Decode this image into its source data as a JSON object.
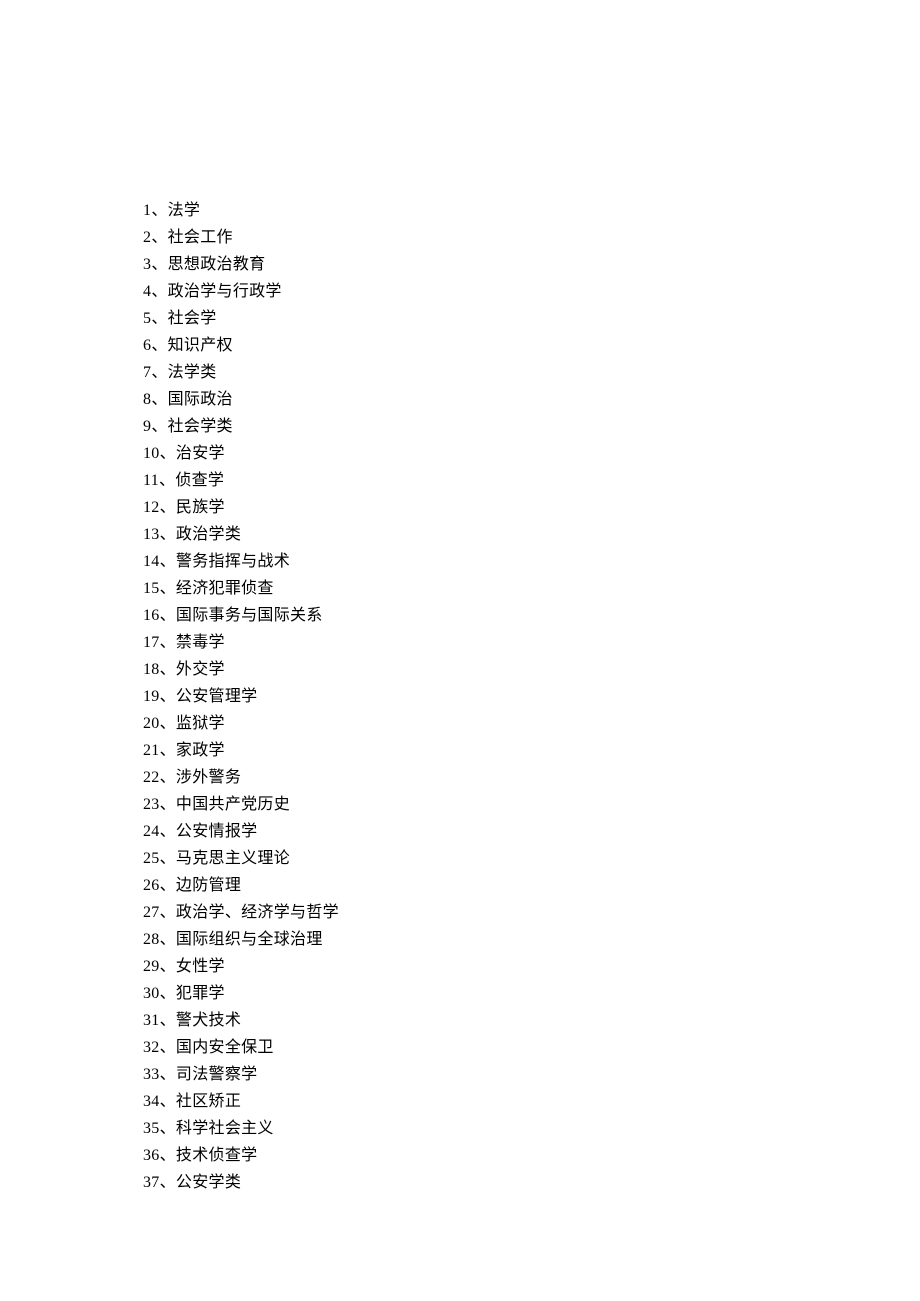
{
  "items": [
    {
      "num": "1",
      "label": "法学"
    },
    {
      "num": "2",
      "label": "社会工作"
    },
    {
      "num": "3",
      "label": "思想政治教育"
    },
    {
      "num": "4",
      "label": "政治学与行政学"
    },
    {
      "num": "5",
      "label": "社会学"
    },
    {
      "num": "6",
      "label": "知识产权"
    },
    {
      "num": "7",
      "label": "法学类"
    },
    {
      "num": "8",
      "label": "国际政治"
    },
    {
      "num": "9",
      "label": "社会学类"
    },
    {
      "num": "10",
      "label": "治安学"
    },
    {
      "num": "11",
      "label": "侦查学"
    },
    {
      "num": "12",
      "label": "民族学"
    },
    {
      "num": "13",
      "label": "政治学类"
    },
    {
      "num": "14",
      "label": "警务指挥与战术"
    },
    {
      "num": "15",
      "label": "经济犯罪侦查"
    },
    {
      "num": "16",
      "label": "国际事务与国际关系"
    },
    {
      "num": "17",
      "label": "禁毒学"
    },
    {
      "num": "18",
      "label": "外交学"
    },
    {
      "num": "19",
      "label": "公安管理学"
    },
    {
      "num": "20",
      "label": "监狱学"
    },
    {
      "num": "21",
      "label": "家政学"
    },
    {
      "num": "22",
      "label": "涉外警务"
    },
    {
      "num": "23",
      "label": "中国共产党历史"
    },
    {
      "num": "24",
      "label": "公安情报学"
    },
    {
      "num": "25",
      "label": "马克思主义理论"
    },
    {
      "num": "26",
      "label": "边防管理"
    },
    {
      "num": "27",
      "label": "政治学、经济学与哲学"
    },
    {
      "num": "28",
      "label": "国际组织与全球治理"
    },
    {
      "num": "29",
      "label": "女性学"
    },
    {
      "num": "30",
      "label": "犯罪学"
    },
    {
      "num": "31",
      "label": "警犬技术"
    },
    {
      "num": "32",
      "label": "国内安全保卫"
    },
    {
      "num": "33",
      "label": "司法警察学"
    },
    {
      "num": "34",
      "label": "社区矫正"
    },
    {
      "num": "35",
      "label": "科学社会主义"
    },
    {
      "num": "36",
      "label": "技术侦查学"
    },
    {
      "num": "37",
      "label": "公安学类"
    }
  ],
  "separator": "、"
}
